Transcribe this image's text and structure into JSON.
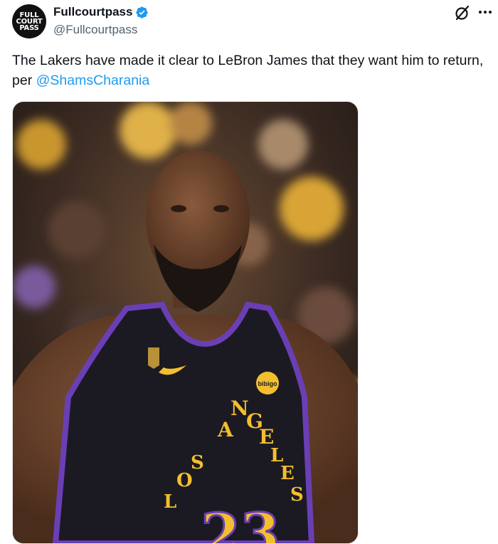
{
  "author": {
    "display_name": "Fullcourtpass",
    "handle": "@Fullcourtpass",
    "avatar_lines": [
      "FULL",
      "COURT",
      "PASS"
    ],
    "verified": true
  },
  "tweet": {
    "text": "The Lakers have made it clear to LeBron James that they want him to return, per ",
    "mention": "@ShamsCharania"
  },
  "media": {
    "jersey_word_letters": [
      "L",
      "O",
      "S",
      "A",
      "N",
      "G",
      "E",
      "L",
      "E",
      "S"
    ],
    "jersey_number": "23",
    "patch_text": "bibigo"
  },
  "icons": {
    "verified": "verified-badge-icon",
    "grok": "grok-icon",
    "more": "more-options-icon"
  },
  "colors": {
    "accent": "#1d9bf0",
    "jersey": "#1b1a22",
    "jersey_trim": "#6a3fb5",
    "lakers_gold": "#f4bf2e"
  }
}
